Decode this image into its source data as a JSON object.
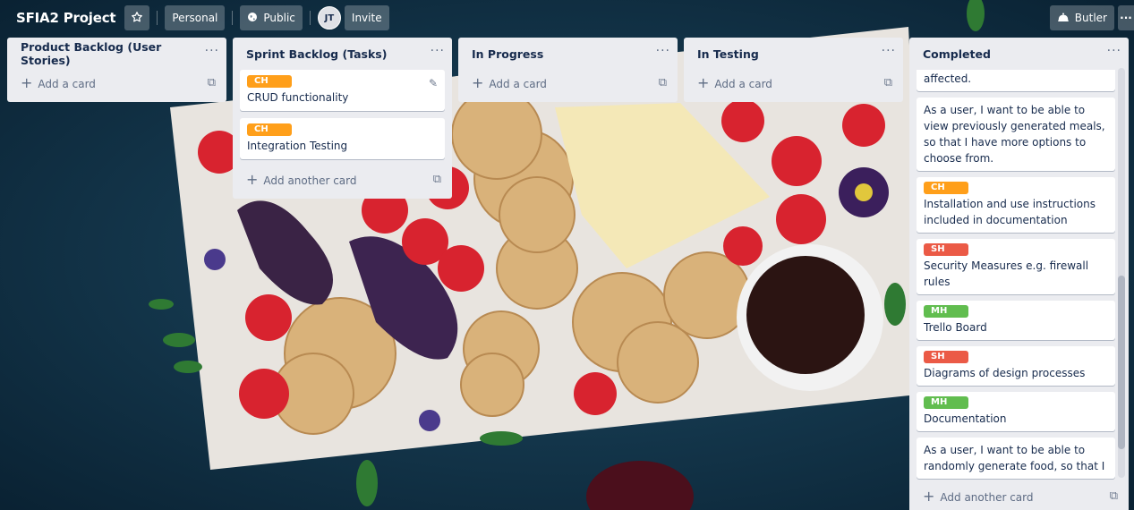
{
  "board": {
    "title": "SFIA2 Project",
    "star_icon": "star-icon",
    "personal_label": "Personal",
    "visibility_label": "Public",
    "avatar_initials": "JT",
    "invite_label": "Invite",
    "butler_label": "Butler",
    "more_label": "···"
  },
  "colors": {
    "orange": "#ff9f1a",
    "red": "#eb5a46",
    "green": "#61bd4f",
    "list_bg": "#ebecf0"
  },
  "lists": [
    {
      "title": "Product Backlog (User Stories)",
      "menu": "···",
      "cards": [],
      "composer": "Add a card"
    },
    {
      "title": "Sprint Backlog (Tasks)",
      "menu": "···",
      "cards": [
        {
          "label": "CH",
          "label_color": "orange",
          "text": "CRUD functionality"
        },
        {
          "label": "CH",
          "label_color": "orange",
          "text": "Integration Testing"
        }
      ],
      "composer": "Add another card"
    },
    {
      "title": "In Progress",
      "menu": "···",
      "cards": [],
      "composer": "Add a card"
    },
    {
      "title": "In Testing",
      "menu": "···",
      "cards": [],
      "composer": "Add a card"
    },
    {
      "title": "Completed",
      "menu": "···",
      "cards": [
        {
          "label": "",
          "text": "that my user-experience is not affected."
        },
        {
          "label": "",
          "text": "As a user, I want to be able to view previously generated meals, so that I have more options to choose from."
        },
        {
          "label": "CH",
          "label_color": "orange",
          "text": "Installation and use instructions included in documentation"
        },
        {
          "label": "SH",
          "label_color": "red",
          "text": "Security Measures e.g. firewall rules"
        },
        {
          "label": "MH",
          "label_color": "green",
          "text": "Trello Board"
        },
        {
          "label": "SH",
          "label_color": "red",
          "text": "Diagrams of design processes"
        },
        {
          "label": "MH",
          "label_color": "green",
          "text": "Documentation"
        },
        {
          "label": "",
          "text": "As a user, I want to be able to randomly generate food, so that I"
        }
      ],
      "composer": "Add another card"
    }
  ]
}
